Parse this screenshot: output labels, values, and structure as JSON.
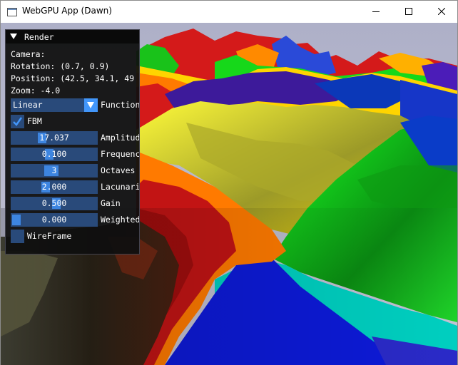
{
  "window": {
    "title": "WebGPU App (Dawn)",
    "controls": {
      "minimize_icon": "minimize-icon",
      "maximize_icon": "maximize-icon",
      "close_icon": "close-icon"
    }
  },
  "panel": {
    "title": "Render",
    "camera_label": "Camera:",
    "rotation": "Rotation: (0.7, 0.9)",
    "position": "Position: (42.5, 34.1, 49",
    "zoom": "Zoom: -4.0",
    "function_select": {
      "value": "Linear",
      "label": "Function"
    },
    "fbm": {
      "label": "FBM",
      "checked": true
    },
    "sliders": [
      {
        "label": "Amplitude",
        "value": "17.037",
        "fraction": 0.34
      },
      {
        "label": "Frequency",
        "value": "0.100",
        "fraction": 0.41
      },
      {
        "label": "Octaves",
        "value": "3",
        "fraction": 0.4
      },
      {
        "label": "Lacunarity",
        "value": "2.000",
        "fraction": 0.37
      },
      {
        "label": "Gain",
        "value": "0.500",
        "fraction": 0.5
      },
      {
        "label": "Weighted",
        "value": "0.000",
        "fraction": 0.0
      }
    ],
    "wireframe": {
      "label": "WireFrame",
      "checked": false
    }
  }
}
